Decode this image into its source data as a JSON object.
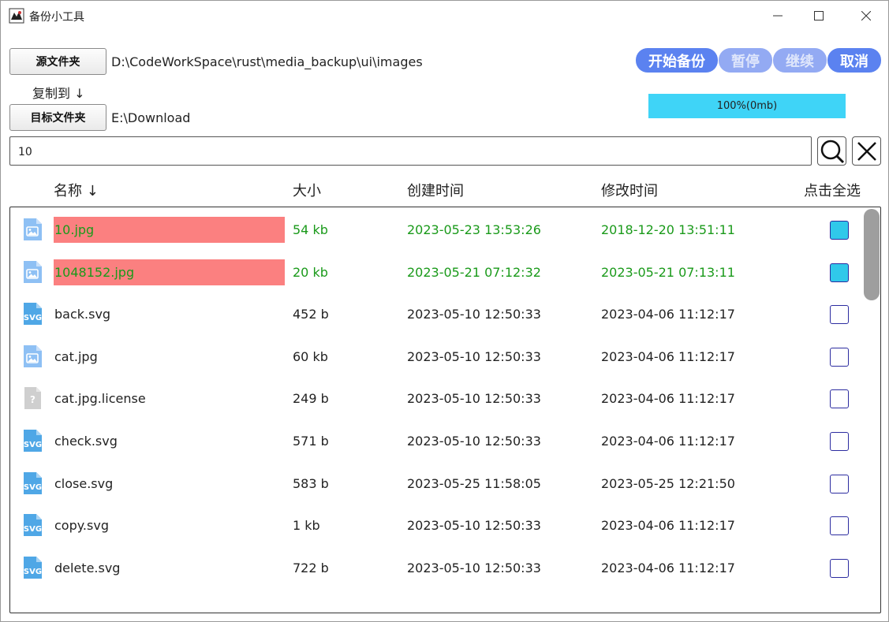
{
  "window": {
    "title": "备份小工具"
  },
  "source": {
    "button_label": "源文件夹",
    "path": "D:\\CodeWorkSpace\\rust\\media_backup\\ui\\images"
  },
  "copy_to_label": "复制到 ↓",
  "target": {
    "button_label": "目标文件夹",
    "path": "E:\\Download"
  },
  "actions": {
    "start": "开始备份",
    "pause": "暂停",
    "resume": "继续",
    "cancel": "取消"
  },
  "progress": {
    "text": "100%(0mb)",
    "fraction": 1.0
  },
  "search": {
    "value": "10"
  },
  "columns": {
    "name": "名称 ↓",
    "size": "大小",
    "created": "创建时间",
    "modified": "修改时间",
    "select_all": "点击全选"
  },
  "files": [
    {
      "name": "10.jpg",
      "size": "54 kb",
      "created": "2023-05-23 13:53:26",
      "modified": "2018-12-20 13:51:11",
      "icon": "image-file-icon",
      "matched": true,
      "checked": true
    },
    {
      "name": "1048152.jpg",
      "size": "20 kb",
      "created": "2023-05-21 07:12:32",
      "modified": "2023-05-21 07:13:11",
      "icon": "image-file-icon",
      "matched": true,
      "checked": true
    },
    {
      "name": "back.svg",
      "size": "452 b",
      "created": "2023-05-10 12:50:33",
      "modified": "2023-04-06 11:12:17",
      "icon": "svg-file-icon",
      "matched": false,
      "checked": false
    },
    {
      "name": "cat.jpg",
      "size": "60 kb",
      "created": "2023-05-10 12:50:33",
      "modified": "2023-04-06 11:12:17",
      "icon": "image-file-icon",
      "matched": false,
      "checked": false
    },
    {
      "name": "cat.jpg.license",
      "size": "249 b",
      "created": "2023-05-10 12:50:33",
      "modified": "2023-04-06 11:12:17",
      "icon": "unknown-file-icon",
      "matched": false,
      "checked": false
    },
    {
      "name": "check.svg",
      "size": "571 b",
      "created": "2023-05-10 12:50:33",
      "modified": "2023-04-06 11:12:17",
      "icon": "svg-file-icon",
      "matched": false,
      "checked": false
    },
    {
      "name": "close.svg",
      "size": "583 b",
      "created": "2023-05-25 11:58:05",
      "modified": "2023-05-25 12:21:50",
      "icon": "svg-file-icon",
      "matched": false,
      "checked": false
    },
    {
      "name": "copy.svg",
      "size": "1 kb",
      "created": "2023-05-10 12:50:33",
      "modified": "2023-04-06 11:12:17",
      "icon": "svg-file-icon",
      "matched": false,
      "checked": false
    },
    {
      "name": "delete.svg",
      "size": "722 b",
      "created": "2023-05-10 12:50:33",
      "modified": "2023-04-06 11:12:17",
      "icon": "svg-file-icon",
      "matched": false,
      "checked": false
    }
  ],
  "colors": {
    "accent": "#5b82f0",
    "accent_disabled": "#93aaf3",
    "progress": "#3fd4f7",
    "match_highlight": "#fb8080",
    "match_text": "#1a9a1a",
    "checkbox_checked": "#30c8ea"
  }
}
